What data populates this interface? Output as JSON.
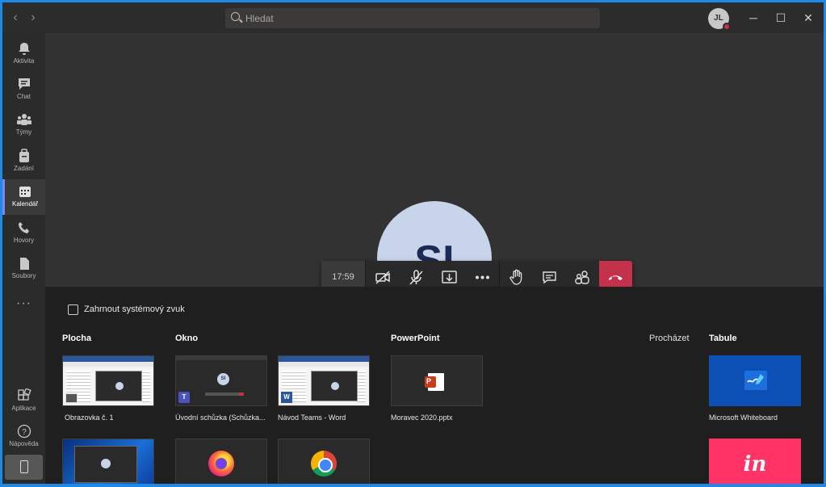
{
  "titlebar": {
    "search_placeholder": "Hledat",
    "avatar_initials": "JL"
  },
  "rail": {
    "items": [
      {
        "label": "Aktivita",
        "icon": "bell-icon"
      },
      {
        "label": "Chat",
        "icon": "chat-icon"
      },
      {
        "label": "Týmy",
        "icon": "teams-icon"
      },
      {
        "label": "Zadání",
        "icon": "assignments-icon"
      },
      {
        "label": "Kalendář",
        "icon": "calendar-icon",
        "active": true
      },
      {
        "label": "Hovory",
        "icon": "phone-icon"
      },
      {
        "label": "Soubory",
        "icon": "files-icon"
      }
    ],
    "more": "···",
    "bottom": [
      {
        "label": "Aplikace",
        "icon": "apps-icon"
      },
      {
        "label": "Nápověda",
        "icon": "help-icon"
      }
    ]
  },
  "stage": {
    "participant_initials": "SI"
  },
  "callbar": {
    "timer": "17:59"
  },
  "share": {
    "include_audio_label": "Zahrnout systémový zvuk",
    "include_audio_checked": false,
    "sections": {
      "desktop": "Plocha",
      "window": "Okno",
      "powerpoint": "PowerPoint",
      "browse": "Procházet",
      "whiteboard": "Tabule"
    },
    "tiles": {
      "screen1": "Obrazovka č. 1",
      "teams_window": "Úvodní schůzka (Schůzka...",
      "word_window": "Návod Teams - Word",
      "pptx": "Moravec 2020.pptx",
      "whiteboard": "Microsoft Whiteboard"
    },
    "tile_badges": {
      "word": "W",
      "teams": "T",
      "pptx": "P",
      "invision": "in",
      "teams_participant": "SI"
    }
  },
  "colors": {
    "accent": "#7f85f5",
    "hangup": "#c4314b",
    "whiteboard": "#0c4fb5",
    "invision": "#ff3366",
    "window_border": "#1f8ae6"
  }
}
